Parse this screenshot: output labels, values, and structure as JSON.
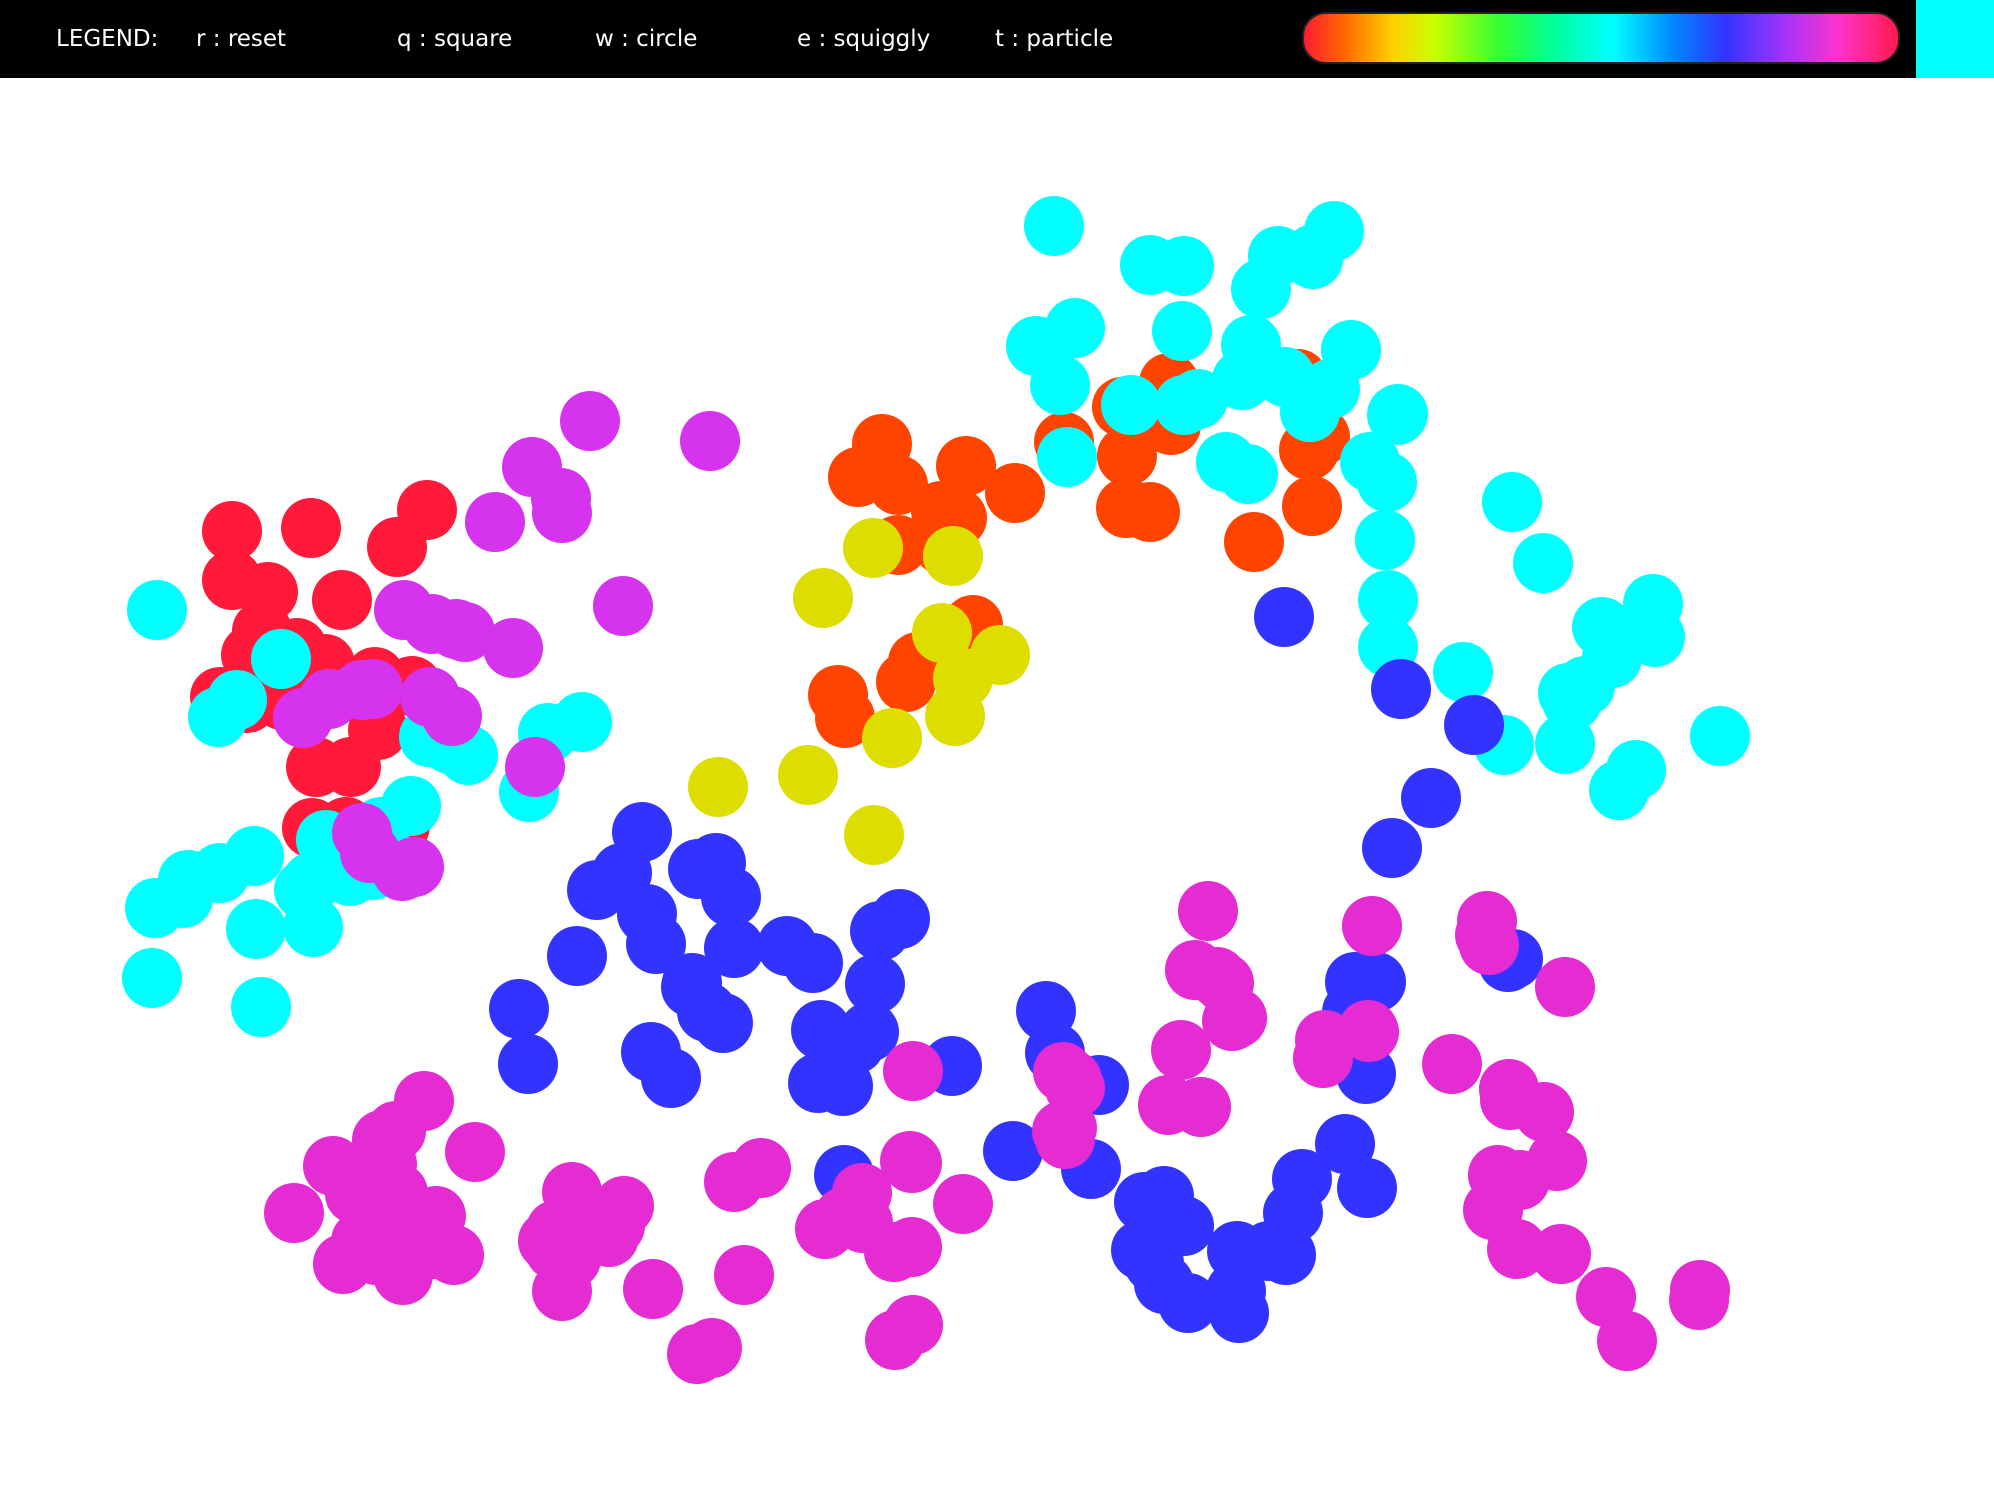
{
  "legend": {
    "title": "LEGEND:",
    "items": [
      {
        "key": "r",
        "label": "r : reset"
      },
      {
        "key": "q",
        "label": "q : square"
      },
      {
        "key": "w",
        "label": "w : circle"
      },
      {
        "key": "e",
        "label": "e : squiggly"
      },
      {
        "key": "t",
        "label": "t : particle"
      }
    ]
  },
  "current_color": "#00ffff",
  "palette": {
    "red": "#ff1a3a",
    "orange": "#ff4400",
    "yellow": "#dddd00",
    "cyan": "#00ffff",
    "purple": "#d633ee",
    "blue": "#3333ff",
    "magenta": "#e52bd2"
  }
}
